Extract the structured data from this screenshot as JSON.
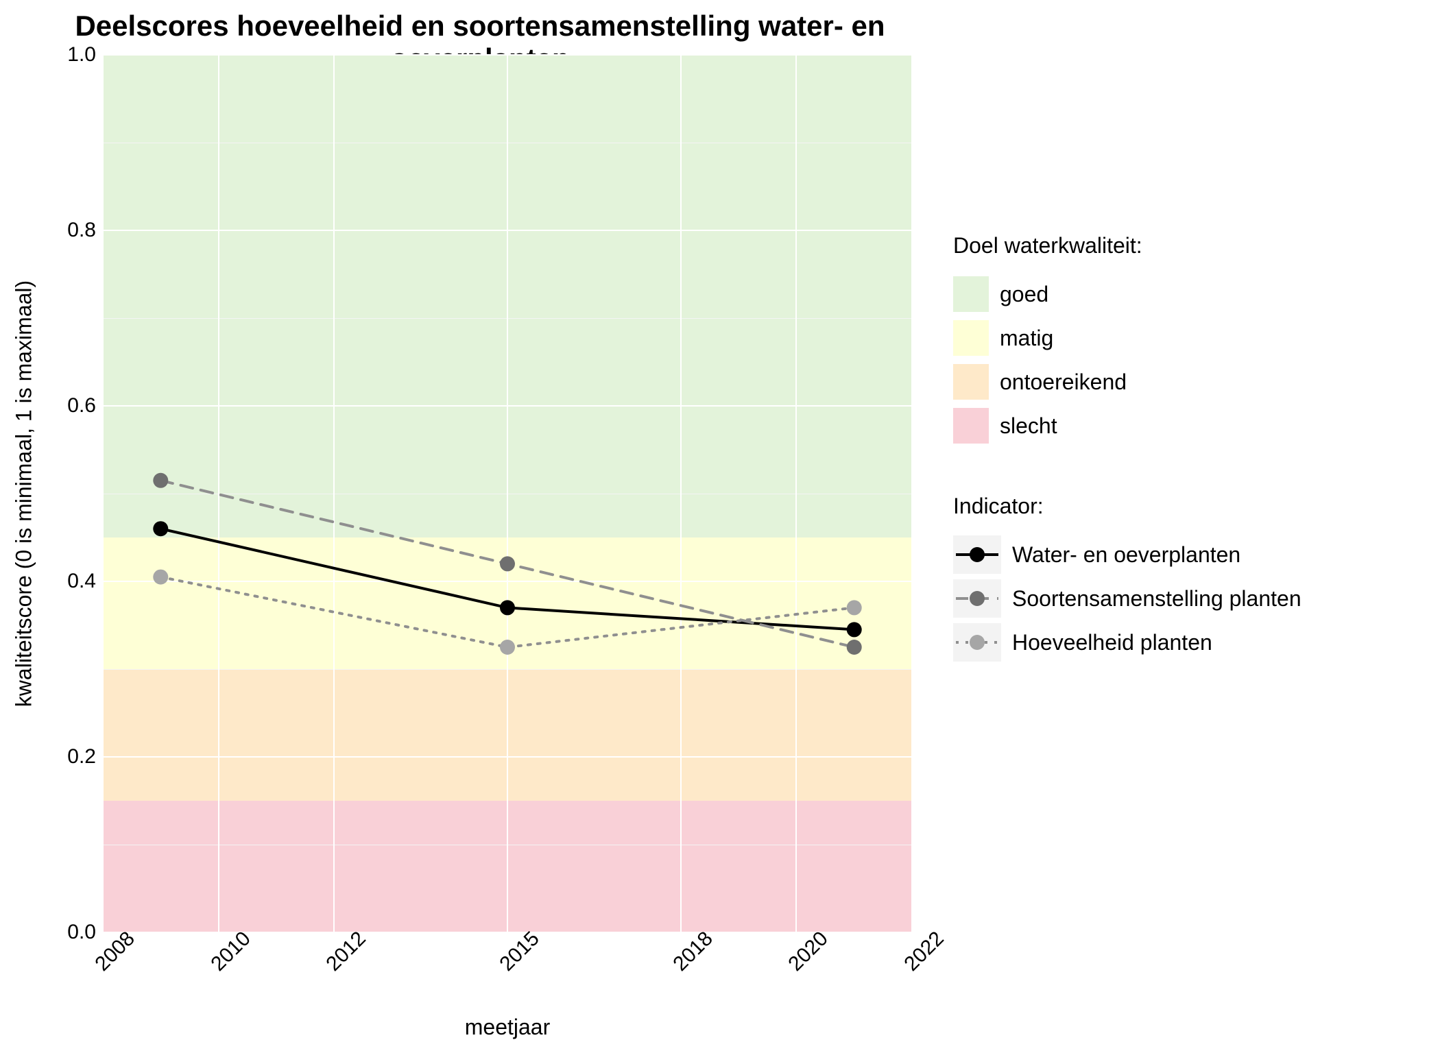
{
  "chart_data": {
    "type": "line",
    "title": "Deelscores hoeveelheid en soortensamenstelling water- en oeverplanten",
    "xlabel": "meetjaar",
    "ylabel": "kwaliteitscore (0 is minimaal, 1 is maximaal)",
    "x_ticks": [
      2008,
      2010,
      2012,
      2015,
      2018,
      2020,
      2022
    ],
    "y_ticks": [
      0.0,
      0.2,
      0.4,
      0.6,
      0.8,
      1.0
    ],
    "xlim": [
      2008,
      2022
    ],
    "ylim": [
      0.0,
      1.0
    ],
    "bands": {
      "title": "Doel waterkwaliteit:",
      "levels": [
        {
          "name": "goed",
          "from": 0.45,
          "to": 1.0,
          "color": "#e3f3da"
        },
        {
          "name": "matig",
          "from": 0.3,
          "to": 0.45,
          "color": "#feffd6"
        },
        {
          "name": "ontoereikend",
          "from": 0.15,
          "to": 0.3,
          "color": "#fee9c9"
        },
        {
          "name": "slecht",
          "from": 0.0,
          "to": 0.15,
          "color": "#f9d0d7"
        }
      ]
    },
    "indicator_title": "Indicator:",
    "series": [
      {
        "name": "Water- en oeverplanten",
        "style": "solid",
        "point_color": "#000000",
        "line_color": "#000000",
        "x": [
          2009,
          2015,
          2021
        ],
        "y": [
          0.46,
          0.37,
          0.345
        ]
      },
      {
        "name": "Soortensamenstelling planten",
        "style": "dashed",
        "point_color": "#6f6f6f",
        "line_color": "#8f8f8f",
        "x": [
          2009,
          2015,
          2021
        ],
        "y": [
          0.515,
          0.42,
          0.325
        ]
      },
      {
        "name": "Hoeveelheid planten",
        "style": "dotted",
        "point_color": "#a6a6a6",
        "line_color": "#8f8f8f",
        "x": [
          2009,
          2015,
          2021
        ],
        "y": [
          0.405,
          0.325,
          0.37
        ]
      }
    ]
  }
}
